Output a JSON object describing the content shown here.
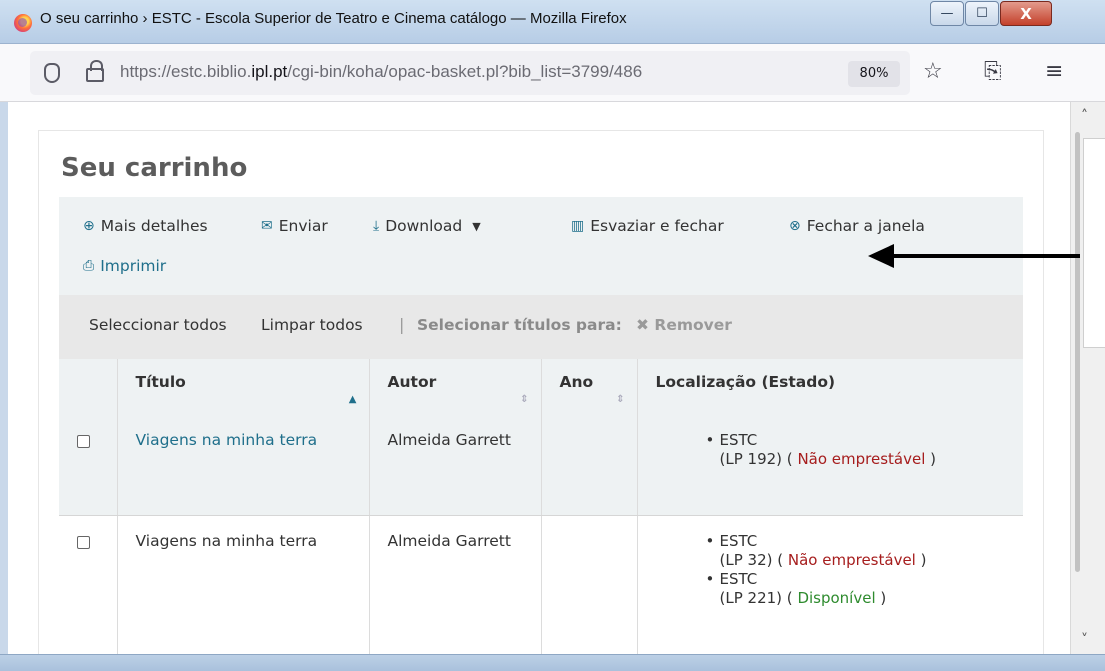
{
  "window": {
    "title": "O seu carrinho › ESTC - Escola Superior de Teatro e Cinema catálogo — Mozilla Firefox",
    "minimize": "—",
    "maximize": "☐",
    "close": "X"
  },
  "browser": {
    "url_host_prefix": "https://estc.biblio.",
    "url_host_bold": "ipl.pt",
    "url_path": "/cgi-bin/koha/opac-basket.pl?bib_list=3799/486",
    "zoom": "80%",
    "icons": [
      "shield-icon",
      "lock-icon",
      "star-icon",
      "extensions-icon",
      "menu-icon"
    ]
  },
  "page": {
    "title": "Seu carrinho",
    "toolbar": {
      "more_details": "Mais detalhes",
      "send": "Enviar",
      "download": "Download",
      "empty_close": "Esvaziar e fechar",
      "close_window": "Fechar a janela",
      "print": "Imprimir"
    },
    "selection": {
      "select_all": "Seleccionar todos",
      "clear_all": "Limpar todos",
      "separator": "|",
      "select_titles_for": "Selecionar títulos para:",
      "remove": "Remover"
    },
    "table": {
      "headers": {
        "title": "Título",
        "author": "Autor",
        "year": "Ano",
        "location": "Localização (Estado)"
      },
      "rows": [
        {
          "title": "Viagens na minha terra",
          "author": "Almeida Garrett",
          "year": "",
          "holdings": [
            {
              "library": "ESTC",
              "callno": "(LP 192)",
              "status_open": "(",
              "status": "Não emprestável",
              "status_close": ")"
            }
          ]
        },
        {
          "title": "Viagens na minha terra",
          "author": "Almeida Garrett",
          "year": "",
          "holdings": [
            {
              "library": "ESTC",
              "callno": "(LP 32)",
              "status_open": "(",
              "status": "Não emprestável",
              "status_close": ")"
            },
            {
              "library": "ESTC",
              "callno": "(LP 221)",
              "status_open": "(",
              "status": "Disponível",
              "status_close": ")"
            }
          ]
        }
      ]
    }
  },
  "colors": {
    "link": "#1f6f8b",
    "not_loanable": "#a61d1d",
    "available": "#2e8b2e",
    "toolbar_bg": "#eef2f3"
  }
}
